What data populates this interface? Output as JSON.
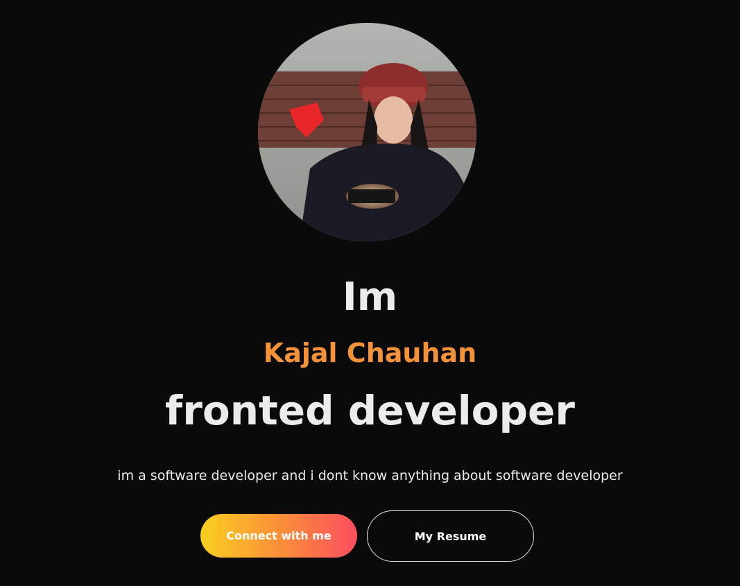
{
  "hero": {
    "avatar": "profile-photo",
    "greeting": "Im",
    "name": "Kajal Chauhan",
    "role": "fronted developer",
    "tagline": "im a software developer and i dont know anything about software developer",
    "buttons": {
      "connect_label": "Connect with me",
      "resume_label": "My Resume"
    }
  },
  "colors": {
    "background": "#0b0a0b",
    "text": "#ececec",
    "accent_name": "#f4923a",
    "button_gradient": [
      "#f9cf1f",
      "#fb8a3c",
      "#fb4d5e"
    ]
  }
}
